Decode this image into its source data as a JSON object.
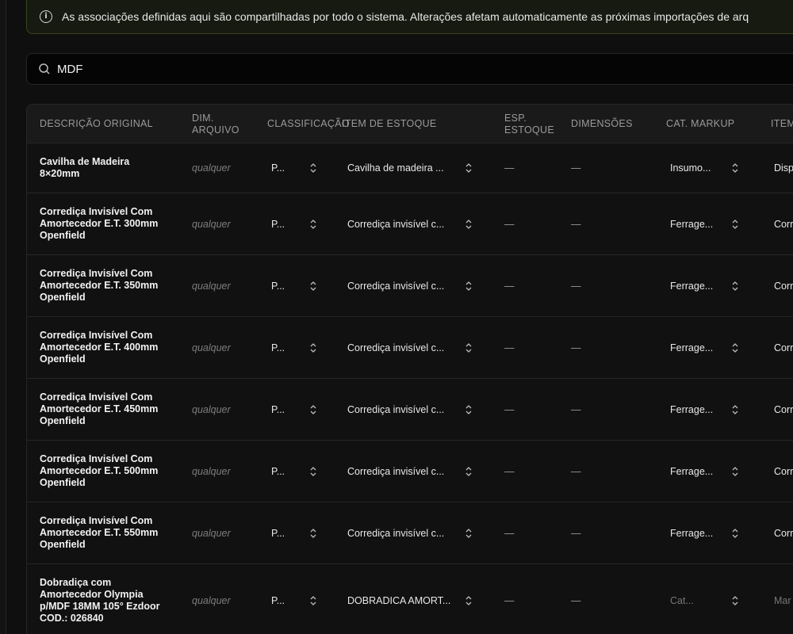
{
  "banner": {
    "text": "As associações definidas aqui são compartilhadas por todo o sistema. Alterações afetam automaticamente as próximas importações de arq"
  },
  "search": {
    "value": "MDF"
  },
  "table": {
    "headers": {
      "descricao_original": "DESCRIÇÃO ORIGINAL",
      "dim_arquivo_1": "DIM.",
      "dim_arquivo_2": "ARQUIVO",
      "classificacao": "CLASSIFICAÇÃO",
      "item_estoque": "ITEM DE ESTOQUE",
      "esp_estoque_1": "ESP.",
      "esp_estoque_2": "ESTOQUE",
      "dimensoes": "DIMENSÕES",
      "cat_markup": "CAT. MARKUP",
      "item_cut": "ITEM"
    },
    "rows": [
      {
        "desc": [
          "Cavilha de Madeira",
          "8×20mm"
        ],
        "dim": "qualquer",
        "classificacao": "P...",
        "item": "Cavilha de madeira ...",
        "esp": "—",
        "dimensoes": "—",
        "markup": "Insumo...",
        "item_cut": "Disp",
        "placeholder": false
      },
      {
        "desc": [
          "Corrediça Invisível Com",
          "Amortecedor E.T. 300mm",
          "Openfield"
        ],
        "dim": "qualquer",
        "classificacao": "P...",
        "item": "Corrediça invisível c...",
        "esp": "—",
        "dimensoes": "—",
        "markup": "Ferrage...",
        "item_cut": "Corr",
        "placeholder": false
      },
      {
        "desc": [
          "Corrediça Invisível Com",
          "Amortecedor E.T. 350mm",
          "Openfield"
        ],
        "dim": "qualquer",
        "classificacao": "P...",
        "item": "Corrediça invisível c...",
        "esp": "—",
        "dimensoes": "—",
        "markup": "Ferrage...",
        "item_cut": "Corr",
        "placeholder": false
      },
      {
        "desc": [
          "Corrediça Invisível Com",
          "Amortecedor E.T. 400mm",
          "Openfield"
        ],
        "dim": "qualquer",
        "classificacao": "P...",
        "item": "Corrediça invisível c...",
        "esp": "—",
        "dimensoes": "—",
        "markup": "Ferrage...",
        "item_cut": "Corr",
        "placeholder": false
      },
      {
        "desc": [
          "Corrediça Invisível Com",
          "Amortecedor E.T. 450mm",
          "Openfield"
        ],
        "dim": "qualquer",
        "classificacao": "P...",
        "item": "Corrediça invisível c...",
        "esp": "—",
        "dimensoes": "—",
        "markup": "Ferrage...",
        "item_cut": "Corr",
        "placeholder": false
      },
      {
        "desc": [
          "Corrediça Invisível Com",
          "Amortecedor E.T. 500mm",
          "Openfield"
        ],
        "dim": "qualquer",
        "classificacao": "P...",
        "item": "Corrediça invisível c...",
        "esp": "—",
        "dimensoes": "—",
        "markup": "Ferrage...",
        "item_cut": "Corr",
        "placeholder": false
      },
      {
        "desc": [
          "Corrediça Invisível Com",
          "Amortecedor E.T. 550mm",
          "Openfield"
        ],
        "dim": "qualquer",
        "classificacao": "P...",
        "item": "Corrediça invisível c...",
        "esp": "—",
        "dimensoes": "—",
        "markup": "Ferrage...",
        "item_cut": "Corr",
        "placeholder": false
      },
      {
        "desc": [
          "Dobradiça com",
          "Amortecedor Olympia",
          "p/MDF 18MM 105° Ezdoor",
          "COD.: 026840"
        ],
        "dim": "qualquer",
        "classificacao": "P...",
        "item": "DOBRADICA AMORT...",
        "esp": "—",
        "dimensoes": "—",
        "markup": "Cat...",
        "item_cut": "Mar",
        "placeholder": true
      }
    ]
  },
  "colors": {
    "background": "#0f0f0f",
    "banner_border": "#3a4420",
    "border": "#262626",
    "header_text": "#9a9a9a"
  }
}
